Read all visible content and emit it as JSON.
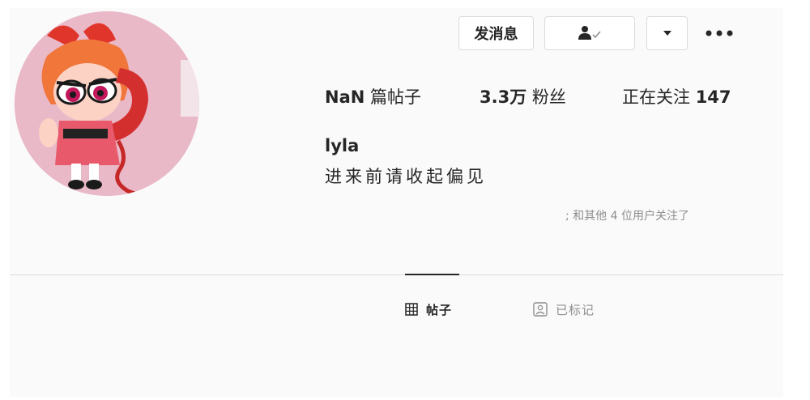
{
  "header": {
    "message_button": "发消息",
    "follow_icon": "person-check-icon",
    "dropdown_icon": "caret-down-icon",
    "more_icon": "more-horizontal-icon"
  },
  "avatar": {
    "icon": "avatar-cartoon-girl-with-phone"
  },
  "stats": {
    "posts_num": "NaN",
    "posts_label": "篇帖子",
    "followers_num": "3.3万",
    "followers_label": "粉丝",
    "following_label": "正在关注",
    "following_num": "147"
  },
  "profile": {
    "username": "lyla",
    "bio": "进来前请收起偏见",
    "followed_by": "; 和其他 4 位用户关注了"
  },
  "tabs": [
    {
      "label": "帖子",
      "icon": "grid-icon",
      "active": true
    },
    {
      "label": "已标记",
      "icon": "tag-icon",
      "active": false
    }
  ],
  "colors": {
    "background": "#fafafa",
    "border": "#dbdbdb",
    "text": "#262626",
    "muted": "#8e8e8e"
  }
}
